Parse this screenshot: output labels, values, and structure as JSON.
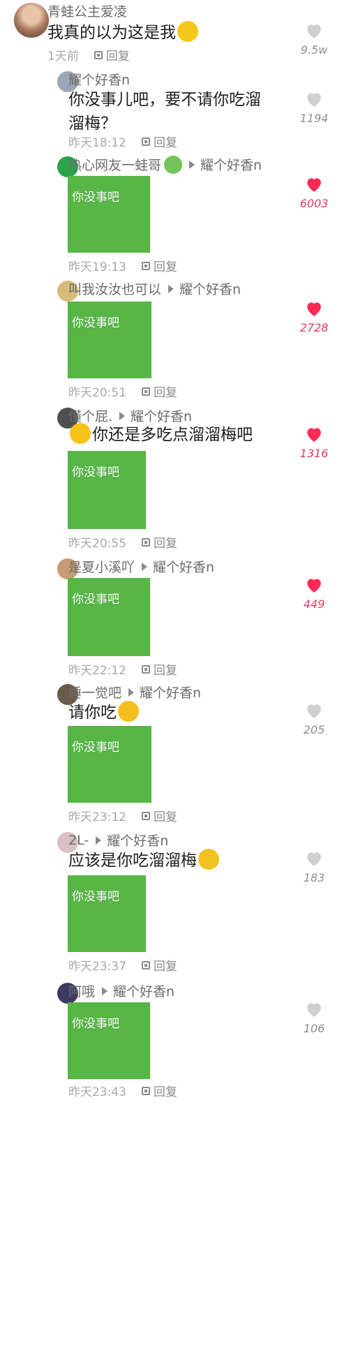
{
  "colors": {
    "heart_liked": "#ff2a55",
    "heart_unliked": "#cfcfcf",
    "meme_green": "#57b646",
    "meta_gray": "#6c6c6c"
  },
  "icons": {
    "like": "heart-icon",
    "reply": "reply-icon",
    "reply_arrow": "reply-arrow-icon"
  },
  "comments": [
    {
      "user": "青蛙公主爱凌",
      "text": "我真的以为这是我",
      "text_emoji": "laughing-emoji-icon",
      "time": "1天前",
      "reply_label": "回复",
      "likes": "9.5w",
      "liked": false
    },
    {
      "user": "耀个好香n",
      "text_line1": "你没事儿吧，要不请你吃溜",
      "text_line2": "溜梅？",
      "time": "昨天18:12",
      "reply_label": "回复",
      "likes": "1194",
      "liked": false
    },
    {
      "user": "热心网友一蛙哥",
      "user_emoji": "frog-emoji-icon",
      "target": "耀个好香n",
      "meme_caption": "你没事吧",
      "time": "昨天19:13",
      "reply_label": "回复",
      "likes": "6003",
      "liked": true
    },
    {
      "user": "叫我汝汝也可以",
      "target": "耀个好香n",
      "meme_caption": "你没事吧",
      "time": "昨天20:51",
      "reply_label": "回复",
      "likes": "2728",
      "liked": true
    },
    {
      "user": "懂个屁.",
      "target": "耀个好香n",
      "text": "你还是多吃点溜溜梅吧",
      "text_emoji": "tears-of-joy-emoji-icon",
      "meme_caption": "你没事吧",
      "time": "昨天20:55",
      "reply_label": "回复",
      "likes": "1316",
      "liked": true
    },
    {
      "user": "是夏小溪吖",
      "target": "耀个好香n",
      "meme_caption": "你没事吧",
      "time": "昨天22:12",
      "reply_label": "回复",
      "likes": "449",
      "liked": true
    },
    {
      "user": "睡一觉吧",
      "target": "耀个好香n",
      "text": "请你吃",
      "text_emoji": "heart-eyes-emoji-icon",
      "meme_caption": "你没事吧",
      "time": "昨天23:12",
      "reply_label": "回复",
      "likes": "205",
      "liked": false
    },
    {
      "user": "2L-",
      "target": "耀个好香n",
      "text": "应该是你吃溜溜梅",
      "text_emoji": "smirk-emoji-icon",
      "meme_caption": "你没事吧",
      "time": "昨天23:37",
      "reply_label": "回复",
      "likes": "183",
      "liked": false
    },
    {
      "user": "阿哦",
      "target": "耀个好香n",
      "meme_caption": "你没事吧",
      "time": "昨天23:43",
      "reply_label": "回复",
      "likes": "106",
      "liked": false
    }
  ]
}
